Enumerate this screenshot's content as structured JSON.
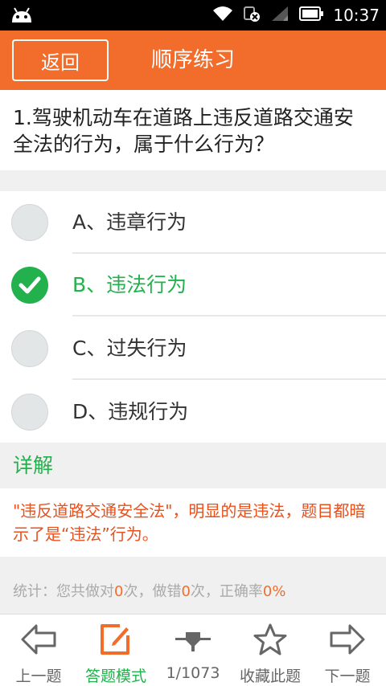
{
  "status_bar": {
    "time": "10:37"
  },
  "header": {
    "back_label": "返回",
    "title": "顺序练习"
  },
  "question": {
    "text": "1.驾驶机动车在道路上违反道路交通安全法的行为，属于什么行为？"
  },
  "options": [
    {
      "label": "A、违章行为",
      "selected": false
    },
    {
      "label": "B、违法行为",
      "selected": true
    },
    {
      "label": "C、过失行为",
      "selected": false
    },
    {
      "label": "D、违规行为",
      "selected": false
    }
  ],
  "explanation": {
    "title": "详解",
    "text": "\"违反道路交通安全法\"，明显的是违法，题目都暗示了是“违法”行为。"
  },
  "stats": {
    "prefix": "统计：您共做对",
    "correct": "0",
    "mid1": "次，做错",
    "wrong": "0",
    "mid2": "次，正确率",
    "rate": "0%"
  },
  "bottom_nav": {
    "prev": "上一题",
    "answer_mode": "答题模式",
    "progress": "1/1073",
    "favorite": "收藏此题",
    "next": "下一题"
  },
  "colors": {
    "accent": "#f26d2b",
    "correct": "#22b14c",
    "explanation_text": "#e8501c"
  }
}
